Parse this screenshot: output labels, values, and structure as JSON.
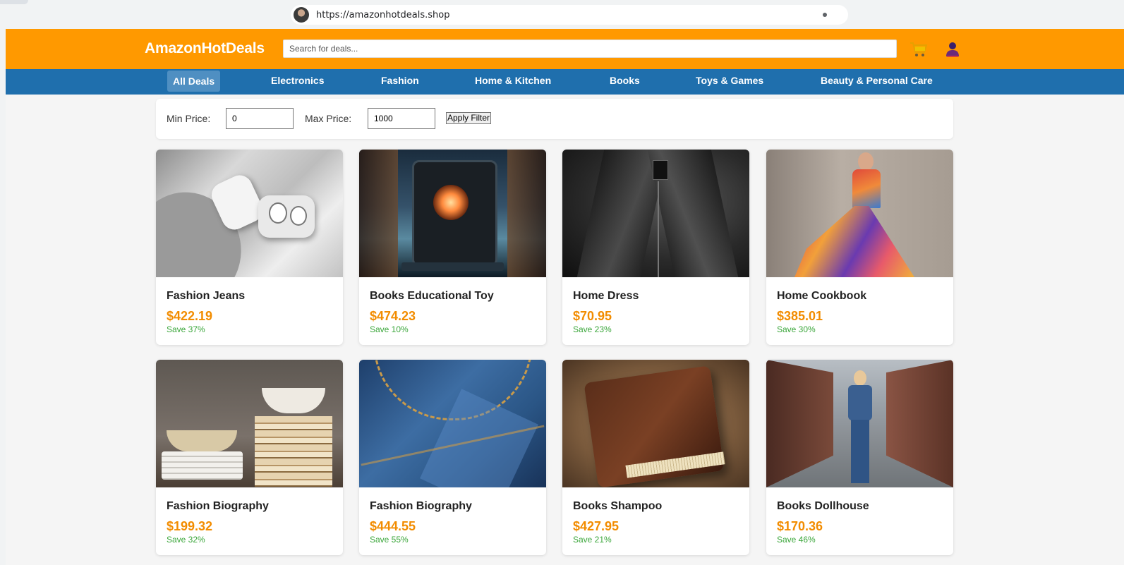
{
  "browser": {
    "url": "https://amazonhotdeals.shop"
  },
  "header": {
    "logo": "AmazonHotDeals",
    "search_placeholder": "Search for deals..."
  },
  "icons": {
    "cart": "shopping-cart-icon",
    "user": "user-icon"
  },
  "nav": {
    "items": [
      {
        "label": "All Deals"
      },
      {
        "label": "Electronics"
      },
      {
        "label": "Fashion"
      },
      {
        "label": "Home & Kitchen"
      },
      {
        "label": "Books"
      },
      {
        "label": "Toys & Games"
      },
      {
        "label": "Beauty & Personal Care"
      }
    ]
  },
  "filter": {
    "min_label": "Min Price:",
    "min_value": "0",
    "max_label": "Max Price:",
    "max_value": "1000",
    "apply_label": "Apply Filter"
  },
  "products": [
    {
      "title": "Fashion Jeans",
      "price": "$422.19",
      "save": "Save 37%"
    },
    {
      "title": "Books Educational Toy",
      "price": "$474.23",
      "save": "Save 10%"
    },
    {
      "title": "Home Dress",
      "price": "$70.95",
      "save": "Save 23%"
    },
    {
      "title": "Home Cookbook",
      "price": "$385.01",
      "save": "Save 30%"
    },
    {
      "title": "Fashion Biography",
      "price": "$199.32",
      "save": "Save 32%"
    },
    {
      "title": "Fashion Biography",
      "price": "$444.55",
      "save": "Save 55%"
    },
    {
      "title": "Books Shampoo",
      "price": "$427.95",
      "save": "Save 21%"
    },
    {
      "title": "Books Dollhouse",
      "price": "$170.36",
      "save": "Save 46%"
    }
  ],
  "colors": {
    "header": "#ff9900",
    "nav": "#1f6fad",
    "price": "#f28c00",
    "save": "#3aa63a"
  }
}
